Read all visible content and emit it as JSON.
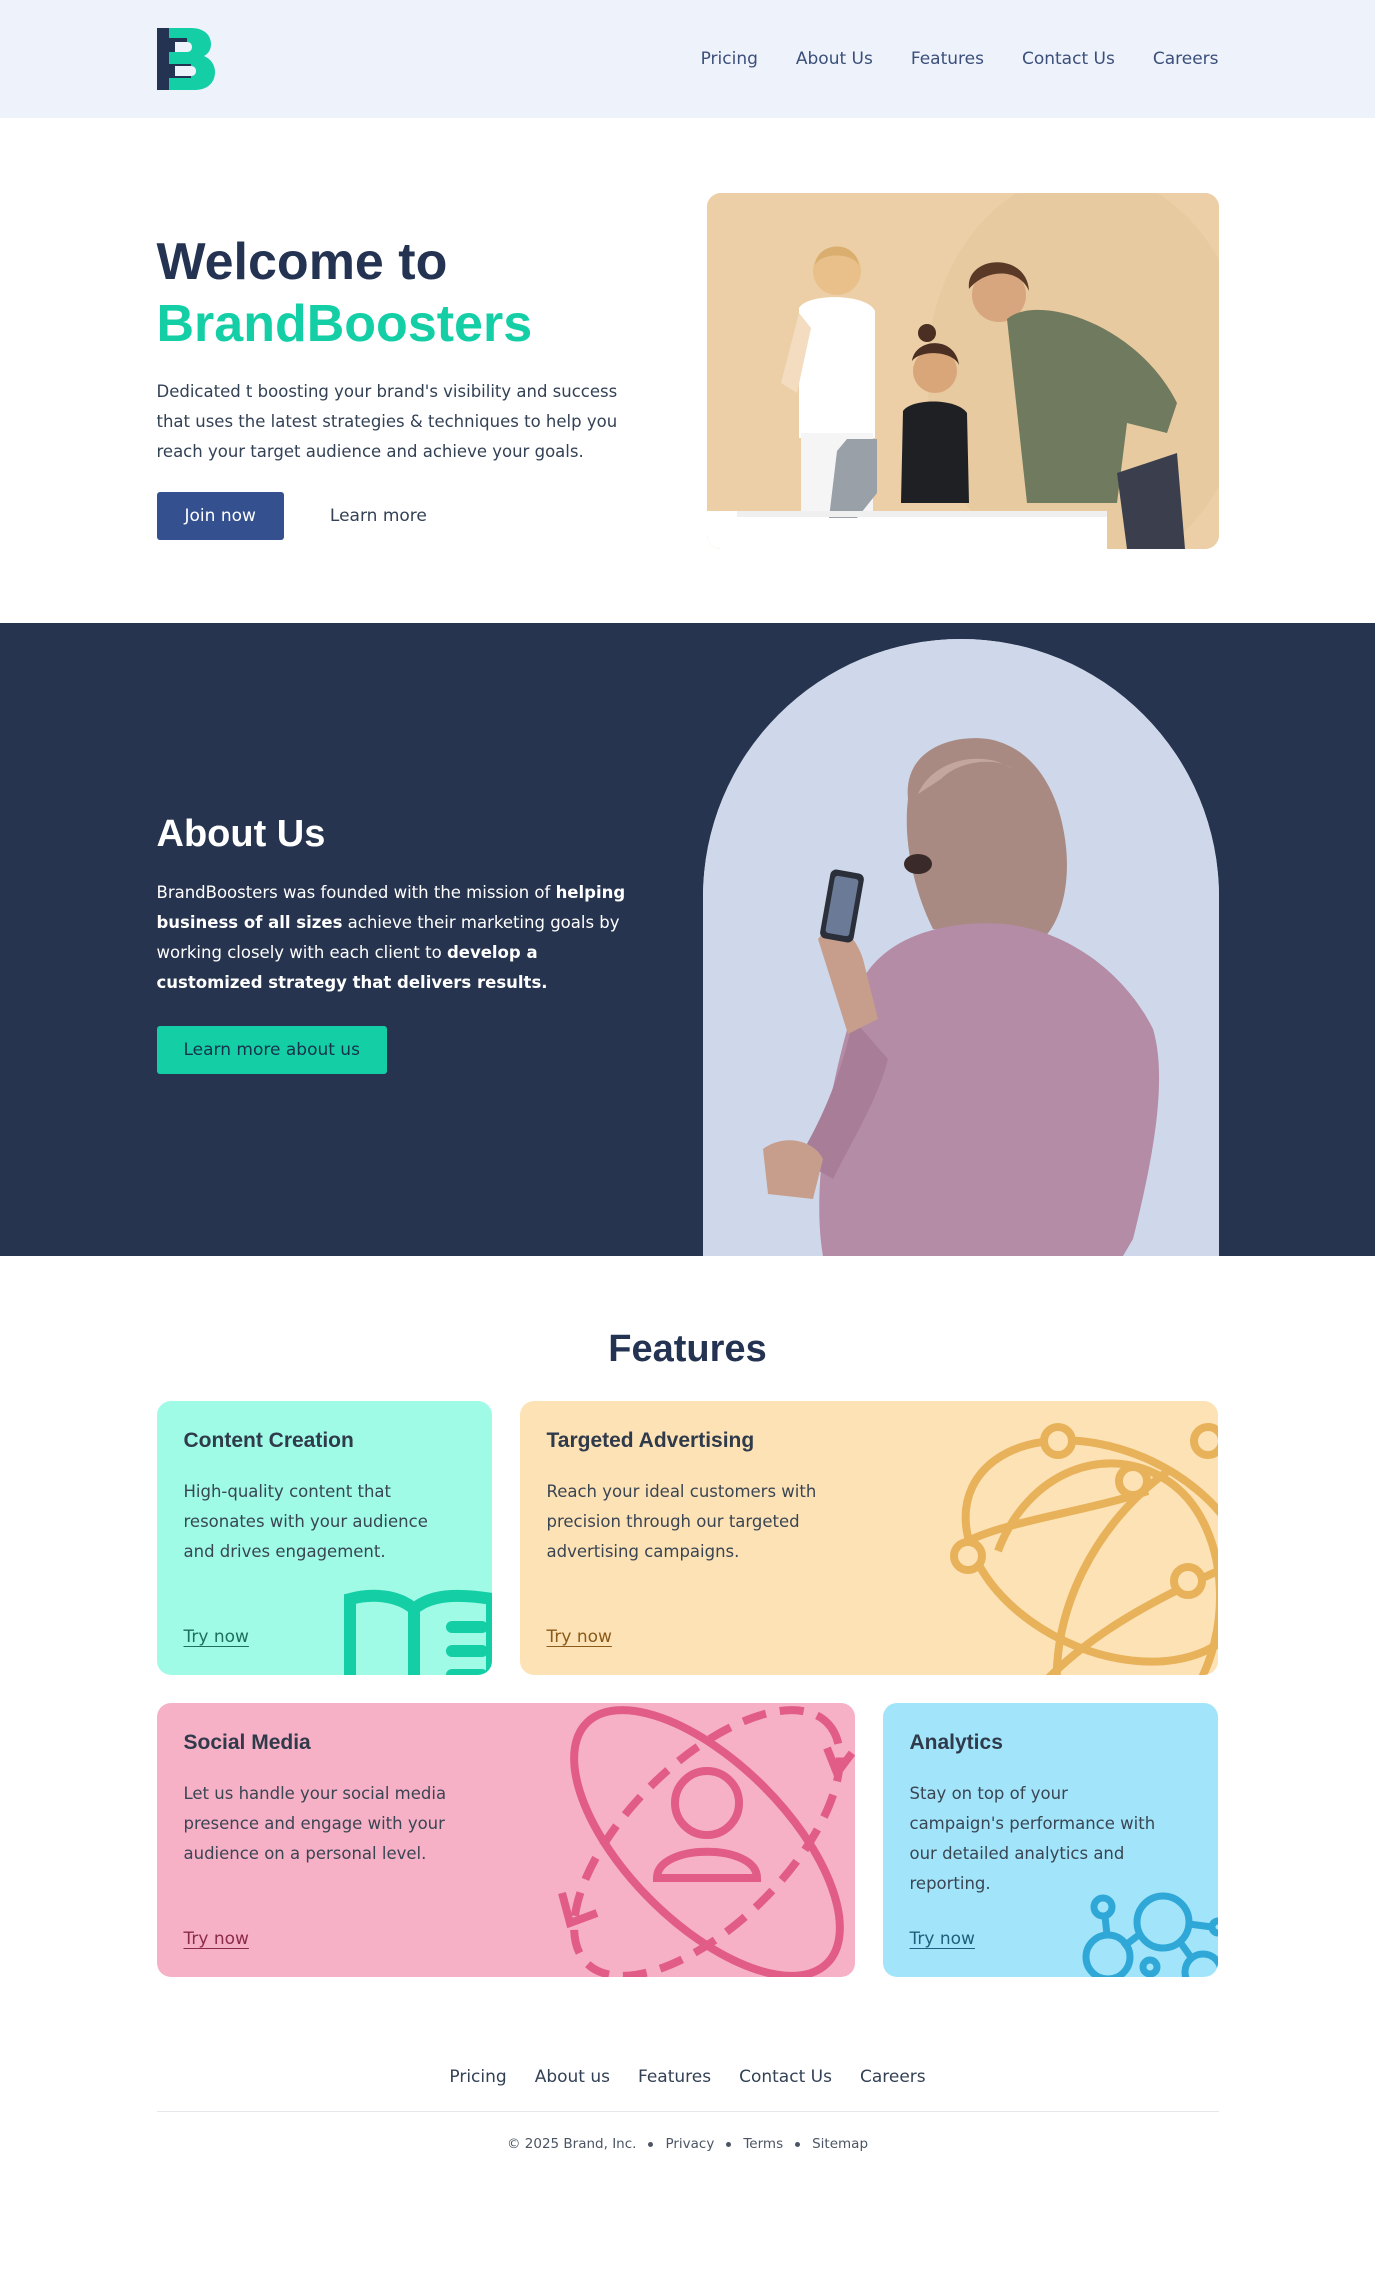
{
  "header": {
    "nav": [
      "Pricing",
      "About Us",
      "Features",
      "Contact Us",
      "Careers"
    ]
  },
  "hero": {
    "title_line1": "Welcome to",
    "title_line2": "BrandBoosters",
    "description": "Dedicated t boosting your brand's visibility and success that uses the latest strategies & techniques to help you reach your target audience and achieve your goals.",
    "primary_button": "Join now",
    "secondary_link": "Learn more"
  },
  "about": {
    "title": "About Us",
    "desc_1": "BrandBoosters was founded with the mission of ",
    "desc_2": "helping business of all sizes",
    "desc_3": " achieve their marketing goals by working closely with each client to ",
    "desc_4": "develop a customized strategy that delivers results.",
    "button": "Learn more about us"
  },
  "features": {
    "title": "Features",
    "cards": [
      {
        "title": "Content Creation",
        "description": "High-quality content that resonates with your audience and drives engagement.",
        "link": "Try now",
        "icon": "book-icon",
        "color": "#9ffbe6"
      },
      {
        "title": "Targeted Advertising",
        "description": "Reach your ideal customers with precision through our targeted advertising campaigns.",
        "link": "Try now",
        "icon": "globe-network-icon",
        "color": "#fde2b6"
      },
      {
        "title": "Social Media",
        "description": "Let us handle your social media presence and engage with your audience on a personal level.",
        "link": "Try now",
        "icon": "user-orbit-icon",
        "color": "#f6b1c7"
      },
      {
        "title": "Analytics",
        "description": "Stay on top of your campaign's performance with our detailed analytics and reporting.",
        "link": "Try now",
        "icon": "molecule-icon",
        "color": "#a2e5fa"
      }
    ]
  },
  "footer": {
    "nav": [
      "Pricing",
      "About us",
      "Features",
      "Contact Us",
      "Careers"
    ],
    "copyright": "© 2025 Brand, Inc.",
    "links": [
      "Privacy",
      "Terms",
      "Sitemap"
    ]
  },
  "colors": {
    "accent": "#14cfa6",
    "navy": "#27344f",
    "primary_button": "#35508f"
  }
}
